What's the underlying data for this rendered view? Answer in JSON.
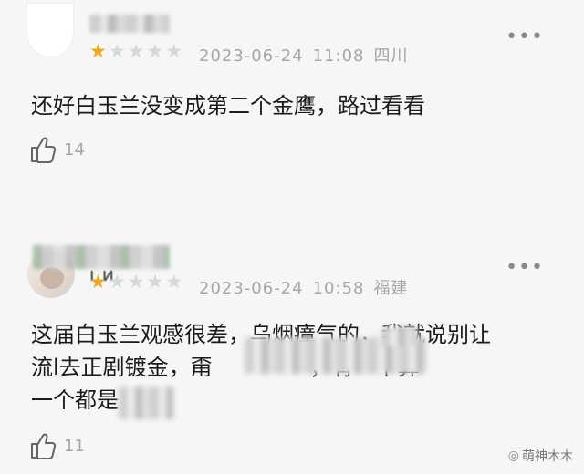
{
  "comments": [
    {
      "rating": 1,
      "rating_max": 5,
      "date": "2023-06-24",
      "time": "11:08",
      "location": "四川",
      "text": "还好白玉兰没变成第二个金鹰，路过看看",
      "likes": "14",
      "more_glyph": "•••"
    },
    {
      "rating": 1,
      "rating_max": 5,
      "date": "2023-06-24",
      "time": "10:58",
      "location": "福建",
      "name_fragment": "ı ᴎ",
      "text": "这届白玉兰观感很差，乌烟瘴气的，我就说别让\n流l去正剧镀金，甭              ，有一个算\n一个都是",
      "likes": "11",
      "more_glyph": "•••"
    }
  ],
  "watermark": {
    "text": "萌神木木",
    "icon": "weibo-like-icon"
  },
  "colors": {
    "star_on": "#f0a81a",
    "star_off": "#d8d8d8",
    "meta": "#a6a6a6",
    "background": "#f6f6f6"
  }
}
